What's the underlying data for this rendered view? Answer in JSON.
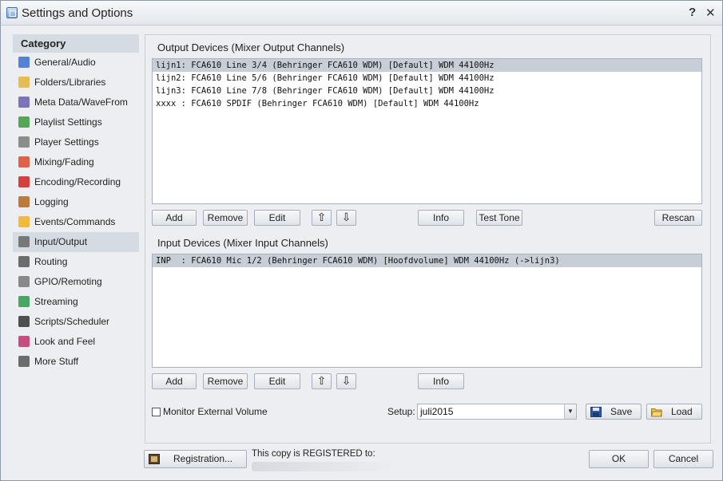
{
  "window": {
    "title": "Settings and Options",
    "help_label": "?",
    "close_label": "✕"
  },
  "sidebar": {
    "header": "Category",
    "items": [
      {
        "label": "General/Audio",
        "icon": "music-note-icon",
        "color": "#3b6fd0"
      },
      {
        "label": "Folders/Libraries",
        "icon": "folder-icon",
        "color": "#e4b43b"
      },
      {
        "label": "Meta Data/WaveFrom",
        "icon": "wave-icon",
        "color": "#6b5cae"
      },
      {
        "label": "Playlist Settings",
        "icon": "playlist-icon",
        "color": "#3a9a3a"
      },
      {
        "label": "Player Settings",
        "icon": "player-icon",
        "color": "#7a7a7a"
      },
      {
        "label": "Mixing/Fading",
        "icon": "crossfade-icon",
        "color": "#d94a2a"
      },
      {
        "label": "Encoding/Recording",
        "icon": "record-icon",
        "color": "#d32020"
      },
      {
        "label": "Logging",
        "icon": "log-book-icon",
        "color": "#b5651d"
      },
      {
        "label": "Events/Commands",
        "icon": "lightning-icon",
        "color": "#f2b01e"
      },
      {
        "label": "Input/Output",
        "icon": "microphone-icon",
        "color": "#666666"
      },
      {
        "label": "Routing",
        "icon": "routing-icon",
        "color": "#555555"
      },
      {
        "label": "GPIO/Remoting",
        "icon": "gpio-icon",
        "color": "#777777"
      },
      {
        "label": "Streaming",
        "icon": "broadcast-icon",
        "color": "#2a9a4a"
      },
      {
        "label": "Scripts/Scheduler",
        "icon": "clock-icon",
        "color": "#333333"
      },
      {
        "label": "Look and Feel",
        "icon": "palette-icon",
        "color": "#c0306a"
      },
      {
        "label": "More Stuff",
        "icon": "tools-icon",
        "color": "#555555"
      }
    ],
    "selected_index": 9
  },
  "output": {
    "label": "Output Devices (Mixer Output Channels)",
    "rows": [
      "lijn1: FCA610 Line 3/4 (Behringer FCA610 WDM) [Default] WDM 44100Hz",
      "lijn2: FCA610 Line 5/6 (Behringer FCA610 WDM) [Default] WDM 44100Hz",
      "lijn3: FCA610 Line 7/8 (Behringer FCA610 WDM) [Default] WDM 44100Hz",
      "xxxx : FCA610 SPDIF (Behringer FCA610 WDM) [Default] WDM 44100Hz"
    ],
    "selected_index": 0,
    "buttons": {
      "add": "Add",
      "remove": "Remove",
      "edit": "Edit",
      "up": "⇧",
      "down": "⇩",
      "info": "Info",
      "test_tone": "Test Tone",
      "rescan": "Rescan"
    }
  },
  "input": {
    "label": "Input Devices (Mixer Input Channels)",
    "rows": [
      "INP  : FCA610 Mic 1/2 (Behringer FCA610 WDM) [Hoofdvolume] WDM 44100Hz (->lijn3)"
    ],
    "selected_index": 0,
    "buttons": {
      "add": "Add",
      "remove": "Remove",
      "edit": "Edit",
      "up": "⇧",
      "down": "⇩",
      "info": "Info"
    }
  },
  "footer": {
    "monitor_label": "Monitor External Volume",
    "monitor_checked": false,
    "setup_label": "Setup:",
    "setup_value": "juli2015",
    "save_label": "Save",
    "load_label": "Load",
    "registration_label": "Registration...",
    "registered_text": "This copy is REGISTERED to:",
    "ok_label": "OK",
    "cancel_label": "Cancel"
  }
}
